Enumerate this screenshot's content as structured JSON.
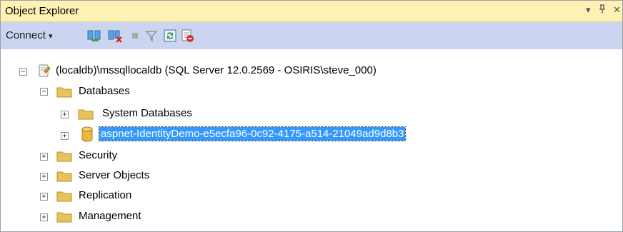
{
  "panel": {
    "title": "Object Explorer",
    "controls": {
      "dropdown": "▾",
      "pin": "ᛖ",
      "close": "✕"
    }
  },
  "toolbar": {
    "connect_label": "Connect",
    "connect_arrow": "▾",
    "buttons": [
      {
        "icon": "connect-icon"
      },
      {
        "icon": "disconnect-icon"
      },
      {
        "icon": "stop-icon"
      },
      {
        "icon": "filter-icon"
      },
      {
        "icon": "refresh-icon"
      },
      {
        "icon": "activity-monitor-icon"
      }
    ]
  },
  "tree": {
    "server": {
      "label": "(localdb)\\mssqllocaldb (SQL Server 12.0.2569 - OSIRIS\\steve_000)",
      "expanded": "⊟"
    },
    "databases": {
      "label": "Databases",
      "expanded": "⊟"
    },
    "system_databases": {
      "label": "System Databases"
    },
    "user_database": {
      "label": "aspnet-IdentityDemo-e5ecfa96-0c92-4175-a514-21049ad9d8b3",
      "selected": true
    },
    "security": {
      "label": "Security"
    },
    "server_objects": {
      "label": "Server Objects"
    },
    "replication": {
      "label": "Replication"
    },
    "management": {
      "label": "Management"
    }
  },
  "colors": {
    "titlebar_bg": "#fff0b3",
    "toolbar_bg": "#ccd5f0",
    "selection_bg": "#3399ff",
    "folder_fill": "#e8c25a"
  }
}
